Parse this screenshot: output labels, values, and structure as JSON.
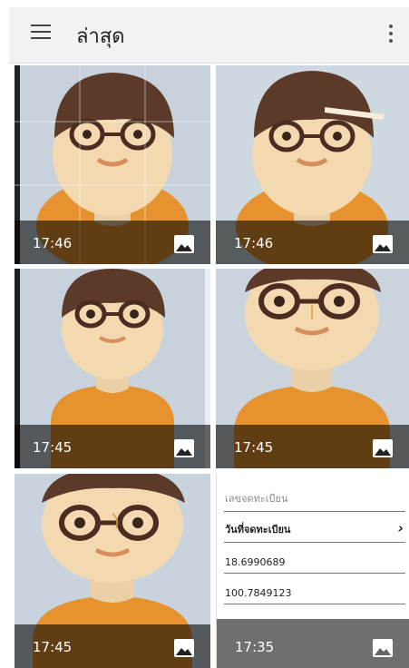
{
  "header": {
    "title": "ล่าสุด",
    "menu_icon": "hamburger-menu-icon",
    "overflow_icon": "more-vert-icon"
  },
  "tiles": [
    {
      "time": "17:46",
      "icon": "image-icon"
    },
    {
      "time": "17:46",
      "icon": "image-icon"
    },
    {
      "time": "17:45",
      "icon": "image-icon"
    },
    {
      "time": "17:45",
      "icon": "image-icon"
    },
    {
      "time": "17:45",
      "icon": "image-icon"
    },
    {
      "time": "17:35",
      "icon": "image-icon"
    }
  ],
  "form": {
    "registration_placeholder": "เลขจดทะเบียน",
    "date_label": "วันที่จดทะเบียน",
    "latitude": "18.6990689",
    "longitude": "100.7849123"
  },
  "colors": {
    "appbar": "#f2f2f2",
    "overlay": "#000000",
    "hair": "#5b3a2a",
    "skin": "#f2d9b0",
    "shirt": "#e6922f",
    "background": "#c9d3dd"
  }
}
